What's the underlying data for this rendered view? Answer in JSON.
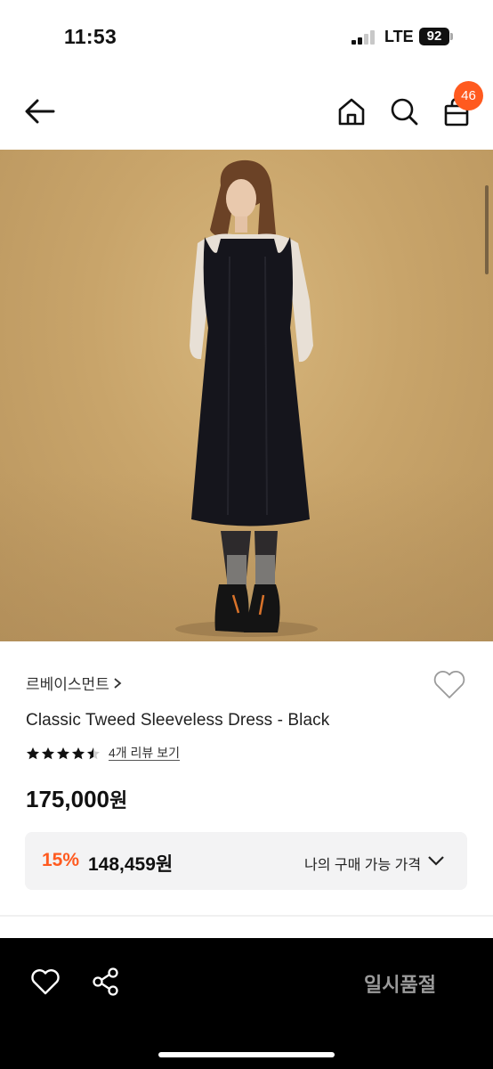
{
  "status_bar": {
    "time": "11:53",
    "network": "LTE",
    "battery": "92"
  },
  "nav": {
    "back_icon": "arrow-left-icon",
    "home_icon": "home-icon",
    "search_icon": "search-icon",
    "bag_icon": "shopping-bag-icon",
    "cart_count": "46",
    "badge_color": "#ff5a1f"
  },
  "product": {
    "image_icon": "product-photo",
    "brand": "르베이스먼트",
    "title": "Classic Tweed Sleeveless Dress - Black",
    "rating": 4.5,
    "rating_max": 5,
    "review_link": "4개 리뷰 보기",
    "price_amount": "175,000",
    "price_unit": "원",
    "discount": {
      "rate": "15%",
      "price": "148,459원",
      "label": "나의 구매 가능 가격"
    }
  },
  "bottom_bar": {
    "wish_icon": "heart-icon",
    "share_icon": "share-icon",
    "status_label": "일시품절"
  },
  "colors": {
    "accent": "#ff5a1f",
    "bottom_bar_bg": "#000000",
    "sold_out_text": "#9a9a9a"
  }
}
